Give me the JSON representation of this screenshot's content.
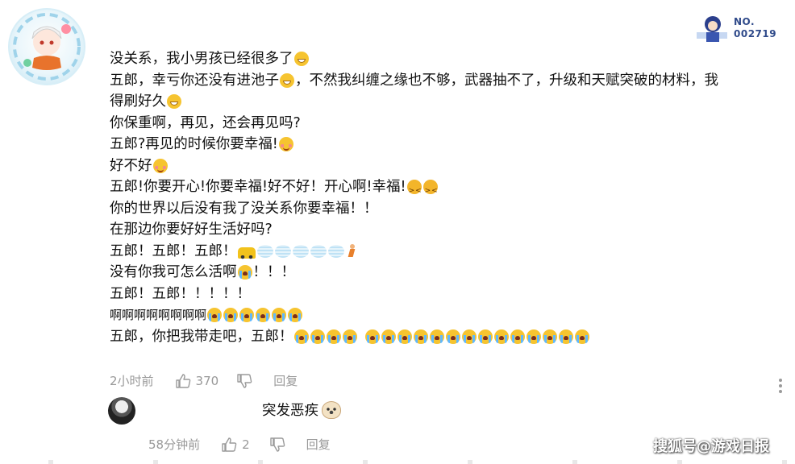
{
  "comment": {
    "lines": [
      {
        "text": "没关系，我小男孩已经很多了",
        "emoji": "grinning-face"
      },
      {
        "text": "五郎，幸亏你还没有进池子",
        "emoji": "grinning-face",
        "text2": "，不然我纠缠之缘也不够，武器抽不了，升级和天赋突破的材料，我"
      },
      {
        "text": "得刷好久",
        "emoji": "grinning-face"
      },
      {
        "text": "你保重啊，再见，还会再见吗?"
      },
      {
        "text": "五郎?再见的时候你要幸福!",
        "emoji": "blushing-face"
      },
      {
        "text": "好不好",
        "emoji": "blushing-face"
      },
      {
        "text": "五郎!你要开心!你要幸福!好不好！开心啊!幸福!",
        "emoji": "confounded-face x2"
      },
      {
        "text": "你的世界以后没有我了没关系你要幸福！！"
      },
      {
        "text": "在那边你要好好生活好吗?"
      },
      {
        "text": "五郎！五郎！五郎！",
        "emoji": "car, wind x5, running-person"
      },
      {
        "text": "没有你我可怎么活啊",
        "emoji": "crying-face",
        "text2": "！！！"
      },
      {
        "text": "五郎！五郎！！！！！"
      },
      {
        "text": "啊啊啊啊啊啊啊啊",
        "emoji": "crying-face x6"
      },
      {
        "text": "五郎，你把我带走吧，五郎！",
        "emoji": "crying-face x4, crying-face x14"
      }
    ],
    "time": "2小时前",
    "like_count": "370",
    "reply_label": "回复"
  },
  "reply": {
    "text": "突发恶疾",
    "emoji": "dog-face",
    "time": "58分钟前",
    "like_count": "2",
    "reply_label": "回复"
  },
  "badge": {
    "line1": "NO.",
    "line2": "002719"
  },
  "watermark": "搜狐号@游戏日报",
  "colors": {
    "meta_gray": "#999999",
    "text": "#111111",
    "badge_blue": "#2f4a8a"
  }
}
